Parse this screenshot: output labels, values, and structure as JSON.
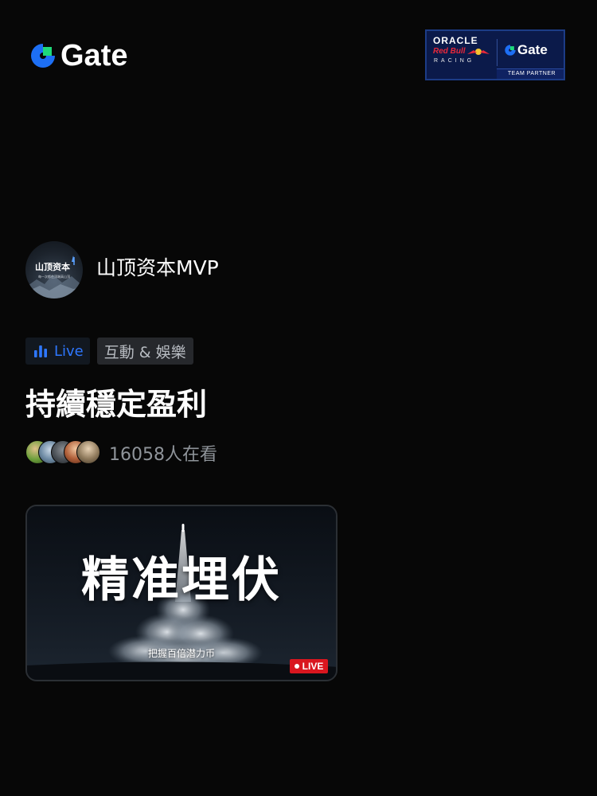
{
  "brand": {
    "name": "Gate",
    "icon": "gate-logo-icon",
    "accent": "#1d6ff5",
    "green": "#1ed97a"
  },
  "partner_badge": {
    "oracle": "ORACLE",
    "red_bull": "Red Bull",
    "racing": "RACING",
    "gate": "Gate",
    "tag": "TEAM PARTNER",
    "background": "#0b1a4a"
  },
  "host": {
    "name": "山顶资本MVP",
    "avatar_title": "山顶资本",
    "avatar_subtitle": "每一次都在顶端高山顶"
  },
  "tags": {
    "live_label": "Live",
    "live_icon": "live-bars-icon",
    "live_color": "#2e77ff",
    "category": "互動 & 娛樂"
  },
  "stream": {
    "title": "持續穩定盈利",
    "viewers_text": "16058人在看"
  },
  "video": {
    "headline": "精准埋伏",
    "subline": "把握百倍潜力币",
    "badge": "LIVE",
    "badge_color": "#d9161f"
  }
}
